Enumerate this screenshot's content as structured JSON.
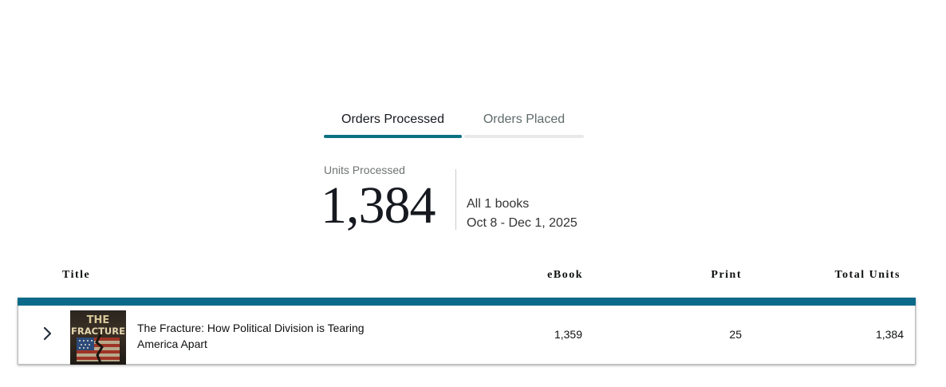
{
  "tabs": {
    "processed": "Orders Processed",
    "placed": "Orders Placed"
  },
  "summary": {
    "units_label": "Units Processed",
    "units_value": "1,384",
    "books_text": "All 1 books",
    "date_range": "Oct 8 - Dec 1, 2025"
  },
  "table": {
    "columns": {
      "title": "Title",
      "ebook": "eBook",
      "print": "Print",
      "total": "Total Units"
    },
    "rows": [
      {
        "title": "The Fracture: How Political Division is Tearing America Apart",
        "ebook": "1,359",
        "print": "25",
        "total": "1,384",
        "cover_text_top": "THE",
        "cover_text_bottom": "FRACTURE"
      }
    ]
  },
  "icons": {
    "expand": "chevron-right-icon"
  },
  "colors": {
    "accent": "#0b7180",
    "table_bar": "#0b6a89",
    "tab_inactive_bar": "#e7e9ea"
  }
}
